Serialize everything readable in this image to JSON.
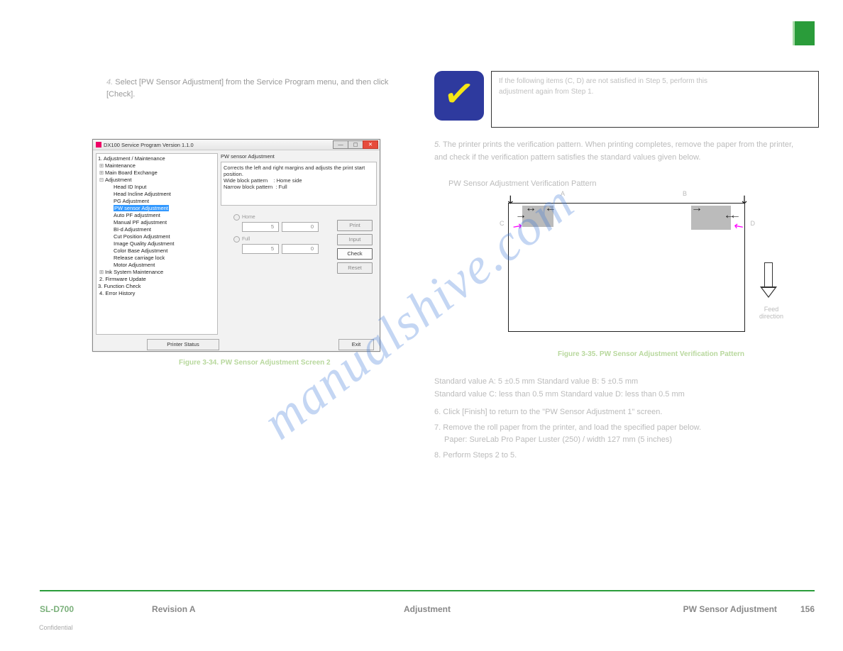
{
  "step4": {
    "label": "4.",
    "text1": "Select [PW Sensor Adjustment] from the Service Program menu, and then click",
    "text2": "[Check]."
  },
  "fig1": "Figure 3-34.   PW Sensor Adjustment Screen 2",
  "app": {
    "title": "DX100 Service Program   Version 1.1.0",
    "tree": {
      "root": "1. Adjustment / Maintenance",
      "maint": "Maintenance",
      "mbe": "Main Board Exchange",
      "adj": "Adjustment",
      "items": [
        "Head ID Input",
        "Head Incline Adjustment",
        "PG Adjustment",
        "PW sensor Adjustment",
        "Auto PF adjustment",
        "Manual PF adjustment",
        "BI-d Adjustment",
        "Cut Position Adjustment",
        "Image Quality Adjustment",
        "Color Base Adjustment",
        "Release carriage lock",
        "Motor Adjustment"
      ],
      "inksys": "Ink System Maintenance",
      "fw": "2. Firmware Update",
      "fc": "3. Function Check",
      "eh": "4. Error History"
    },
    "section_title": "PW sensor Adjustment",
    "desc": {
      "l1": "Corrects the left and right margins and adjusts the print start",
      "l2": "position.",
      "l3a": "Wide block pattern",
      "l3b": ": Home side",
      "l4a": "Narrow block pattern",
      "l4b": ": Full"
    },
    "grp1_label": "Home",
    "grp1_v1": "5",
    "grp1_v2": "0",
    "grp2_label": "Full",
    "grp2_v1": "5",
    "grp2_v2": "0",
    "btn_print": "Print",
    "btn_input": "Input",
    "btn_check": "Check",
    "btn_reset": "Reset",
    "printer_status": "Printer Status",
    "exit": "Exit"
  },
  "checkpoint": {
    "line1": "If the following items (C, D) are not satisfied in Step 5, perform this",
    "line2": "adjustment again from Step 1."
  },
  "right": {
    "step5_label": "5.",
    "step5_text": "The printer prints the verification pattern. When printing completes, remove the paper from the printer, and check if the verification pattern satisfies the standard values given below.",
    "heading": "PW Sensor Adjustment Verification Pattern",
    "labels": {
      "a": "A",
      "b": "B",
      "c": "C",
      "d": "D",
      "feed": "Feed direction"
    }
  },
  "fig2": "Figure 3-35.   PW Sensor Adjustment Verification Pattern",
  "below": {
    "stdA": "Standard value A: 5 ±0.5 mm  Standard value B: 5 ±0.5 mm",
    "stdC": "Standard value C: less than 0.5 mm  Standard value D: less than 0.5 mm",
    "step6_label": "6.",
    "step6_text": "Click [Finish] to return to the \"PW Sensor Adjustment 1\" screen.",
    "step7_label": "7.",
    "step7_text": "Remove the roll paper from the printer, and load the specified paper below.",
    "paper": "Paper: SureLab Pro Paper Luster (250) / width 127 mm (5 inches)",
    "step8_label": "8.",
    "step8_text": "Perform Steps 2 to 5."
  },
  "footer": {
    "left1": "SL-D700",
    "left2": "Revision A",
    "center": "Adjustment",
    "right_title": "PW Sensor Adjustment",
    "page": "156"
  },
  "confidential": "Confidential",
  "watermark": "manualshive.com"
}
